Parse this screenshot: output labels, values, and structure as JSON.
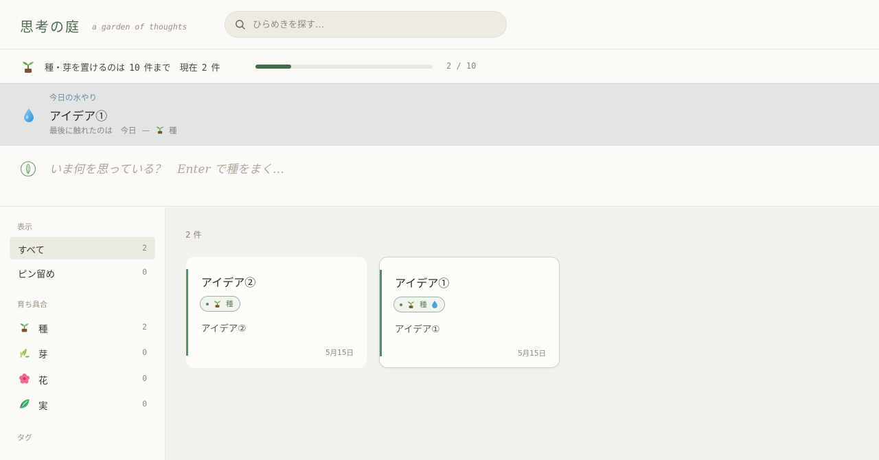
{
  "header": {
    "title": "思考の庭",
    "subtitle": "a garden of thoughts",
    "search_placeholder": "ひらめきを探す…"
  },
  "limit": {
    "text_prefix": "種・芽を置けるのは",
    "max": "10",
    "text_mid": "件まで　現在",
    "current": "2",
    "text_suffix": "件",
    "progress_value": 0.2,
    "progress_label": "2 / 10"
  },
  "watering": {
    "label": "今日の水やり",
    "title": "アイデア①",
    "last_touched_label": "最後に触れたのは　今日",
    "separator": "—",
    "stage": "種"
  },
  "composer": {
    "placeholder": "いま何を思っている？　Enter で種をまく…"
  },
  "sidebar": {
    "view_heading": "表示",
    "view_items": [
      {
        "label": "すべて",
        "count": "2"
      },
      {
        "label": "ピン留め",
        "count": "0"
      }
    ],
    "growth_heading": "育ち具合",
    "growth_items": [
      {
        "label": "種",
        "count": "2",
        "icon": "sprout-icon"
      },
      {
        "label": "芽",
        "count": "0",
        "icon": "herb-icon"
      },
      {
        "label": "花",
        "count": "0",
        "icon": "flower-icon"
      },
      {
        "label": "実",
        "count": "0",
        "icon": "leaf-fruit-icon"
      }
    ],
    "tags_heading": "タグ"
  },
  "main": {
    "result_count": "2 件",
    "cards": [
      {
        "title": "アイデア②",
        "stage": "種",
        "watered": false,
        "body": "アイデア②",
        "date": "5月15日"
      },
      {
        "title": "アイデア①",
        "stage": "種",
        "watered": true,
        "body": "アイデア①",
        "date": "5月15日"
      }
    ]
  },
  "colors": {
    "accent_green": "#3f6b48",
    "water_banner": "#e3e5e4",
    "water_label": "#6a8aa0",
    "card_rail": "#5d8a63"
  }
}
